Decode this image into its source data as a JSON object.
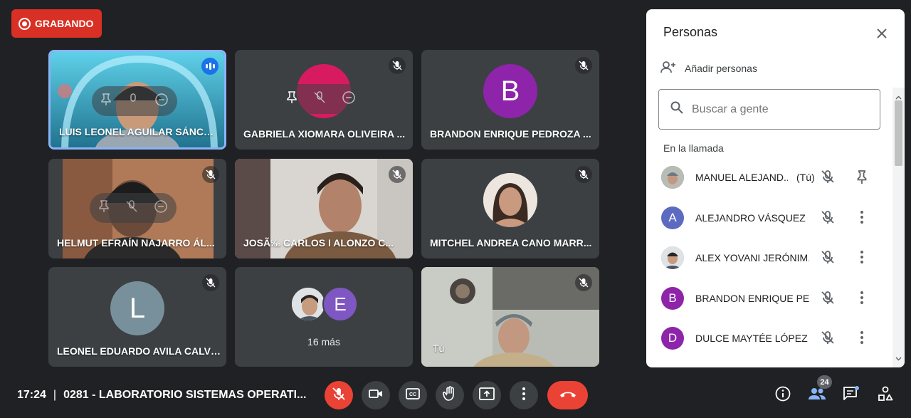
{
  "recording": {
    "label": "GRABANDO"
  },
  "tiles": [
    {
      "name": "LUIS LEONEL AGUILAR SÁNCH...",
      "kind": "video",
      "speaking": true
    },
    {
      "name": "GABRIELA XIOMARA OLIVEIRA ...",
      "kind": "avatar",
      "initial": "",
      "color": "#d81b60"
    },
    {
      "name": "BRANDON ENRIQUE PEDROZA ...",
      "kind": "avatar",
      "initial": "B",
      "color": "#8e24aa"
    },
    {
      "name": "HELMUT EFRAÍN NAJARRO ÁL...",
      "kind": "video"
    },
    {
      "name": "JOSÃ‰ CARLOS I ALONZO C...",
      "kind": "video"
    },
    {
      "name": "MITCHEL ANDREA CANO MARR...",
      "kind": "photo-avatar"
    },
    {
      "name": "LEONEL EDUARDO AVILA CALVI...",
      "kind": "avatar",
      "initial": "L",
      "color": "#78909c"
    },
    {
      "name": "16 más",
      "kind": "more",
      "initial": "E",
      "color": "#7e57c2"
    },
    {
      "name": "Tú",
      "kind": "video"
    }
  ],
  "panel": {
    "title": "Personas",
    "add_people": "Añadir personas",
    "search_placeholder": "Buscar a gente",
    "section_label": "En la llamada",
    "people": [
      {
        "name": "MANUEL ALEJAND...",
        "suffix": "(Tú)",
        "initial": "",
        "color": "#8d6e63",
        "action": "pin-icon"
      },
      {
        "name": "ALEJANDRO VÁSQUEZ ...",
        "suffix": "",
        "initial": "A",
        "color": "#5c6bc0",
        "action": "more-vert-icon"
      },
      {
        "name": "ALEX YOVANI JERÓNIM...",
        "suffix": "",
        "initial": "",
        "color": "#9e9e9e",
        "action": "more-vert-icon"
      },
      {
        "name": "BRANDON ENRIQUE PE...",
        "suffix": "",
        "initial": "B",
        "color": "#8e24aa",
        "action": "more-vert-icon"
      },
      {
        "name": "DULCE MAYTÉE LÓPEZ ...",
        "suffix": "",
        "initial": "D",
        "color": "#8e24aa",
        "action": "more-vert-icon"
      }
    ]
  },
  "bottom": {
    "time": "17:24",
    "separator": "|",
    "meeting_title": "0281 - LABORATORIO SISTEMAS OPERATI...",
    "participants_count": "24"
  },
  "colors": {
    "accent": "#8ab4f8",
    "danger": "#ea4335",
    "background": "#202124",
    "tile": "#3c4043"
  }
}
